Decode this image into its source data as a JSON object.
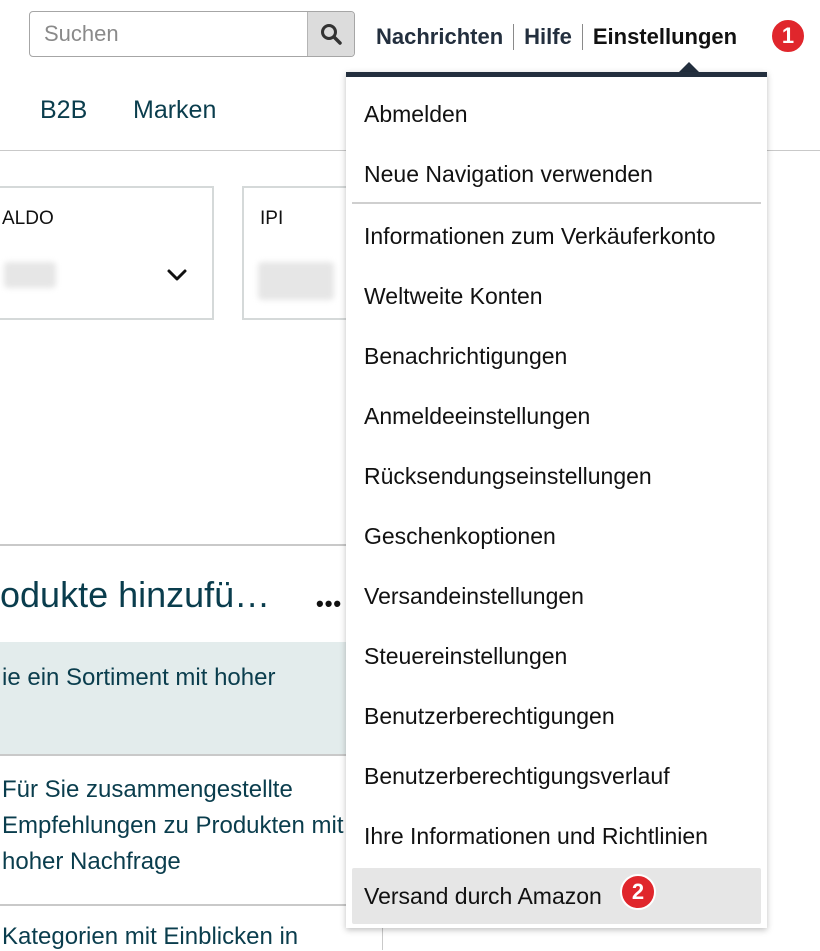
{
  "search": {
    "placeholder": "Suchen"
  },
  "top_nav": {
    "messages": "Nachrichten",
    "help": "Hilfe",
    "settings": "Einstellungen",
    "step_badge_1": "1"
  },
  "sub_nav": {
    "b2b": "B2B",
    "brands": "Marken"
  },
  "cards": [
    {
      "label": "ALDO"
    },
    {
      "label": "IPI"
    }
  ],
  "content": {
    "section_title": "odukte hinzufü…",
    "more": "•••",
    "info_text": "ie ein Sortiment mit hoher",
    "recommendations": "Für Sie zusammengestellte Empfehlungen zu Produkten mit hoher Nachfrage",
    "categories": "Kategorien mit Einblicken in"
  },
  "settings_menu": {
    "items": [
      {
        "label": "Abmelden"
      },
      {
        "label": "Neue Navigation verwenden"
      },
      {
        "label": "Informationen zum Verkäuferkonto"
      },
      {
        "label": "Weltweite Konten"
      },
      {
        "label": "Benachrichtigungen"
      },
      {
        "label": "Anmeldeeinstellungen"
      },
      {
        "label": "Rücksendungseinstellungen"
      },
      {
        "label": "Geschenkoptionen"
      },
      {
        "label": "Versandeinstellungen"
      },
      {
        "label": "Steuereinstellungen"
      },
      {
        "label": "Benutzerberechtigungen"
      },
      {
        "label": "Benutzerberechtigungsverlauf"
      },
      {
        "label": "Ihre Informationen und Richtlinien"
      },
      {
        "label": "Versand durch Amazon",
        "highlighted": true
      }
    ],
    "step_badge_2": "2"
  },
  "colors": {
    "accent_dark": "#232f3e",
    "link_teal": "#0a3d4d",
    "badge_red": "#e0262c",
    "hover_gray": "#e6e6e6"
  },
  "icons": [
    "search-icon",
    "chevron-down-icon",
    "caret-up-icon"
  ]
}
